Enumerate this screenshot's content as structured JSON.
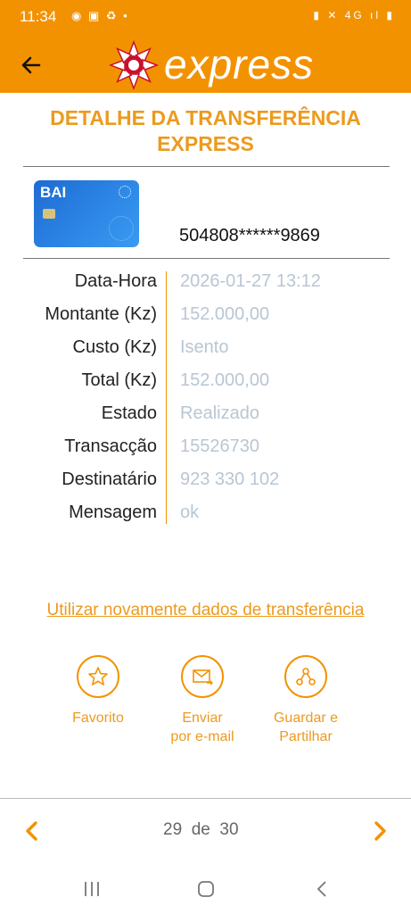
{
  "status_bar": {
    "time": "11:34",
    "left_icons": "◉ ▣ ♻ •",
    "right_icons": "▮ ✕ 4G ıl ▮"
  },
  "header": {
    "logo_text": "express"
  },
  "title": {
    "line1": "DETALHE DA TRANSFERÊNCIA",
    "line2": "EXPRESS"
  },
  "card": {
    "brand": "BAI",
    "number": "504808******9869"
  },
  "details": [
    {
      "label": "Data-Hora",
      "value": "2026-01-27 13:12"
    },
    {
      "label": "Montante (Kz)",
      "value": "152.000,00"
    },
    {
      "label": "Custo (Kz)",
      "value": "Isento"
    },
    {
      "label": "Total (Kz)",
      "value": "152.000,00"
    },
    {
      "label": "Estado",
      "value": "Realizado"
    },
    {
      "label": "Transacção",
      "value": "15526730"
    },
    {
      "label": "Destinatário",
      "value": "923 330 102"
    },
    {
      "label": "Mensagem",
      "value": "ok"
    }
  ],
  "reuse_link": "Utilizar novamente dados de transferência",
  "actions": [
    {
      "line1": "Favorito",
      "line2": "",
      "icon": "star-icon"
    },
    {
      "line1": "Enviar",
      "line2": "por e-mail",
      "icon": "email-icon"
    },
    {
      "line1": "Guardar e",
      "line2": "Partilhar",
      "icon": "share-icon"
    }
  ],
  "pager": {
    "current": "29",
    "sep": "de",
    "total": "30"
  },
  "colors": {
    "accent": "#f39200",
    "title": "#ec9a1e",
    "value": "#b9c6d3"
  }
}
